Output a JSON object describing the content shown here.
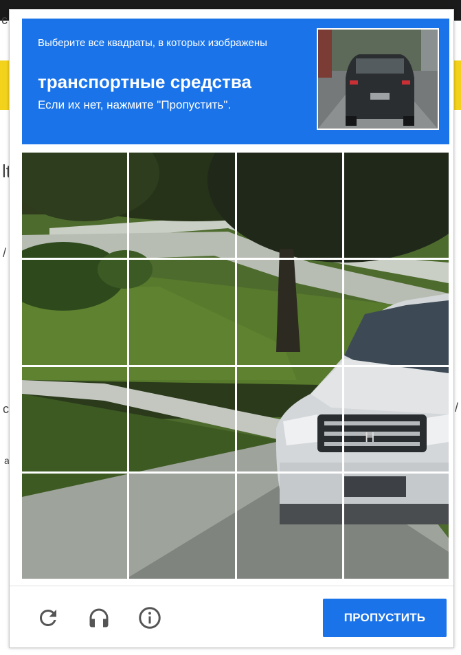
{
  "background": {
    "fragments": [
      "c",
      "lt",
      "/",
      "c",
      "a",
      "/"
    ]
  },
  "captcha": {
    "instruction": "Выберите все квадраты, в которых изображены",
    "target": "транспортные средства",
    "note": "Если их нет, нажмите \"Пропустить\".",
    "grid": {
      "rows": 4,
      "cols": 4
    },
    "footer": {
      "icons": [
        "reload-icon",
        "audio-icon",
        "info-icon"
      ],
      "skip_label": "ПРОПУСТИТЬ"
    },
    "colors": {
      "accent": "#1a73e8"
    }
  }
}
